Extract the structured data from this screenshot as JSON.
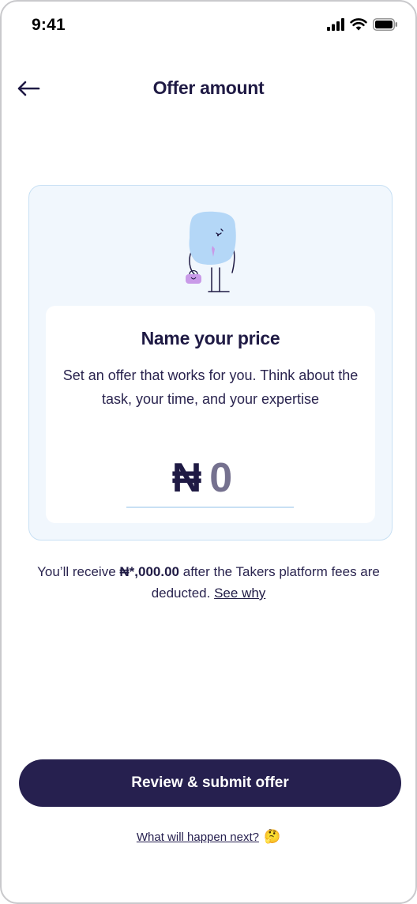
{
  "status_bar": {
    "time": "9:41",
    "icons": [
      "cellular-signal-icon",
      "wifi-icon",
      "battery-icon"
    ]
  },
  "header": {
    "back_icon": "arrow-left-icon",
    "title": "Offer amount"
  },
  "offer_card": {
    "illustration": "character-illustration",
    "title": "Name your price",
    "description": "Set an offer that works for you. Think about the task, your time, and your expertise",
    "currency_symbol": "₦",
    "amount_placeholder": "0"
  },
  "receive_note": {
    "prefix": "You’ll receive ",
    "amount": "₦*,000.00",
    "suffix": " after the Takers platform fees are deducted. ",
    "link_label": "See why"
  },
  "actions": {
    "submit_label": "Review & submit offer",
    "help_link_label": "What will happen next?",
    "help_icon": "🤔"
  },
  "colors": {
    "primary": "#26204f",
    "card_background": "#f1f7fd",
    "card_border": "#c8e0f4",
    "placeholder": "#75718f"
  }
}
